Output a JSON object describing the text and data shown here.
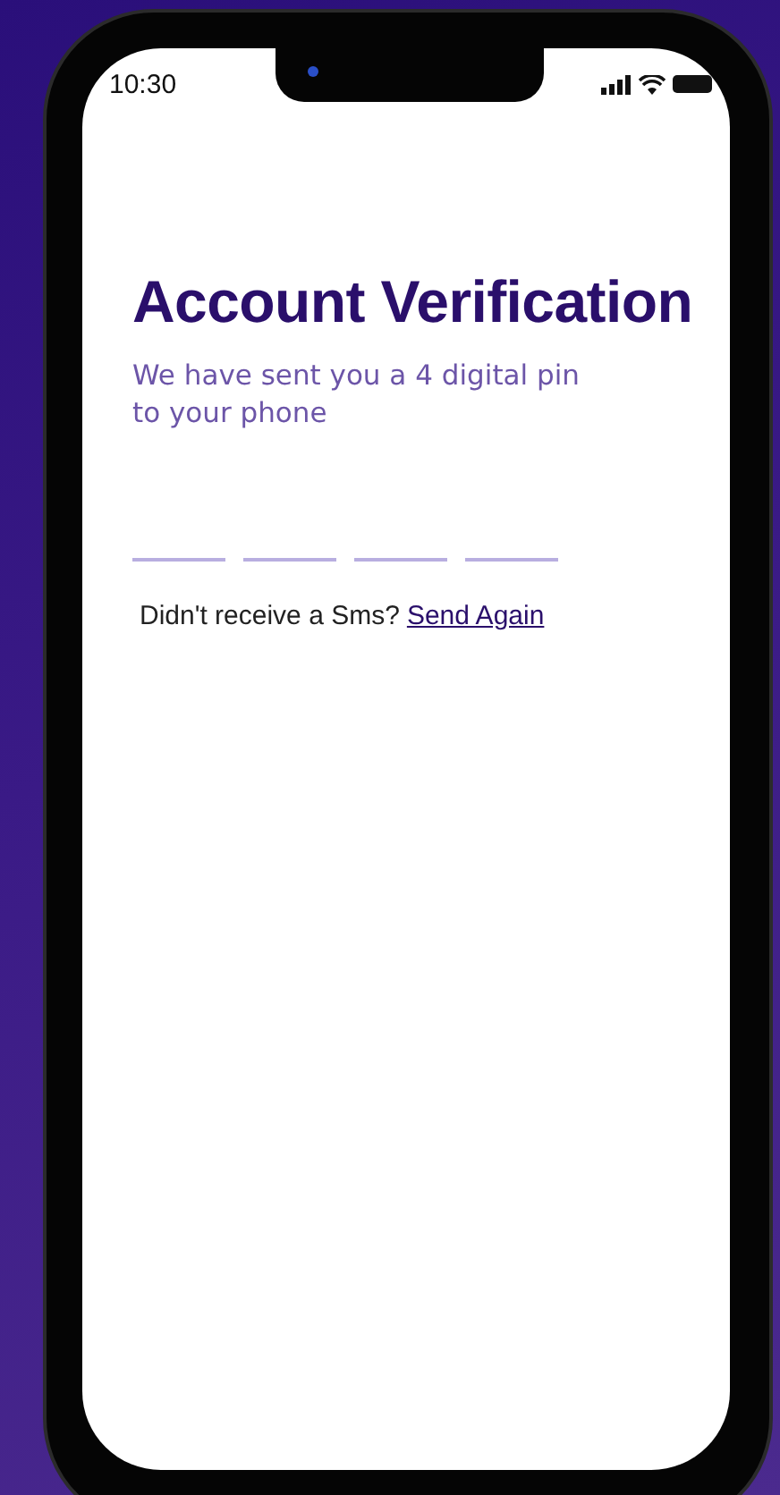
{
  "status_bar": {
    "time": "10:30"
  },
  "title": "Account Verification",
  "subtitle": "We have sent you a 4 digital pin to your phone",
  "pin_fields": [
    {
      "filled": false
    },
    {
      "filled": false
    },
    {
      "filled": false
    },
    {
      "filled": false
    }
  ],
  "resend": {
    "prompt": "Didn't receive a Sms?",
    "link": "Send Again"
  }
}
